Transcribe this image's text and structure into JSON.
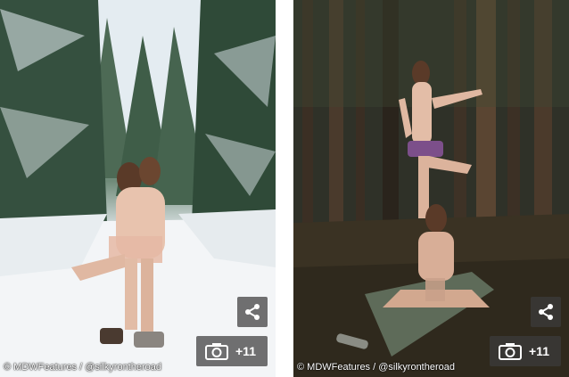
{
  "images": [
    {
      "description_icon": "photo",
      "credit_text": "© MDWFeatures / @silkyrontheroad",
      "share_icon": "share-icon",
      "gallery_icon": "camera-icon",
      "gallery_count": "+11"
    },
    {
      "description_icon": "photo",
      "credit_text": "© MDWFeatures / @silkyrontheroad",
      "share_icon": "share-icon",
      "gallery_icon": "camera-icon",
      "gallery_count": "+11"
    }
  ],
  "colors": {
    "overlay": "#3c3c3c",
    "text": "#ffffff"
  }
}
